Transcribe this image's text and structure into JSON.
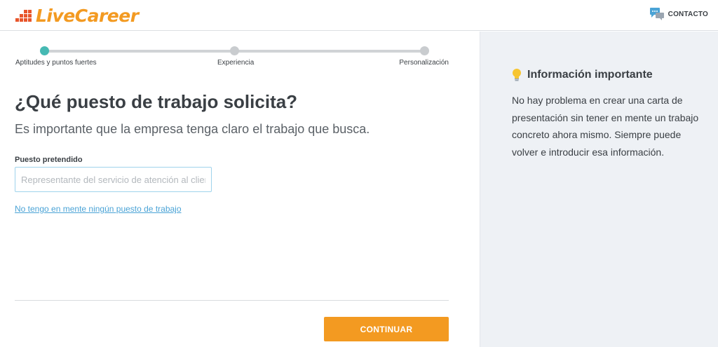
{
  "header": {
    "logo_text": "LiveCareer",
    "contact_label": "CONTACTO"
  },
  "progress": {
    "steps": [
      {
        "label": "Aptitudes y puntos fuertes",
        "active": true
      },
      {
        "label": "Experiencia",
        "active": false
      },
      {
        "label": "Personalización",
        "active": false
      }
    ]
  },
  "main": {
    "title": "¿Qué puesto de trabajo solicita?",
    "subtitle": "Es importante que la empresa tenga claro el trabajo que busca.",
    "job_field": {
      "label": "Puesto pretendido",
      "value": "",
      "placeholder": "Representante del servicio de atención al cliente"
    },
    "no_job_link": "No tengo en mente ningún puesto de trabajo",
    "continue_label": "CONTINUAR"
  },
  "sidebar": {
    "title": "Información importante",
    "body": "No hay problema en crear una carta de presentación sin tener en mente un trabajo concreto ahora mismo. Siempre puede volver e introducir esa información."
  },
  "colors": {
    "brand_orange": "#f39a21",
    "logo_mark": "#e8552b",
    "active_step": "#46b9b3",
    "link": "#4aa3d6",
    "sidebar_bg": "#eef1f5"
  },
  "icons": {
    "logo": "livecareer-logo-icon",
    "contact": "chat-bubbles-icon",
    "info": "lightbulb-icon"
  }
}
